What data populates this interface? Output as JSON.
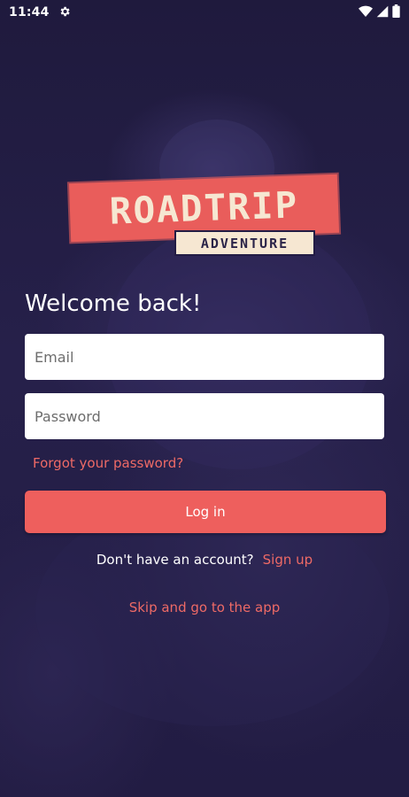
{
  "status_bar": {
    "time": "11:44",
    "icons": [
      "gear-icon",
      "wifi-icon",
      "signal-icon",
      "battery-icon"
    ]
  },
  "logo": {
    "main": "ROADTRIP",
    "sub": "ADVENTURE"
  },
  "login": {
    "title": "Welcome back!",
    "email_placeholder": "Email",
    "email_value": "",
    "password_placeholder": "Password",
    "password_value": "",
    "forgot_label": "Forgot your password?",
    "login_label": "Log in",
    "no_account_text": "Don't have an account?",
    "signup_label": "Sign up",
    "skip_label": "Skip and go to the app"
  },
  "colors": {
    "background": "#231c44",
    "accent": "#ee5f5d",
    "logo_cream": "#f6e7d2"
  }
}
